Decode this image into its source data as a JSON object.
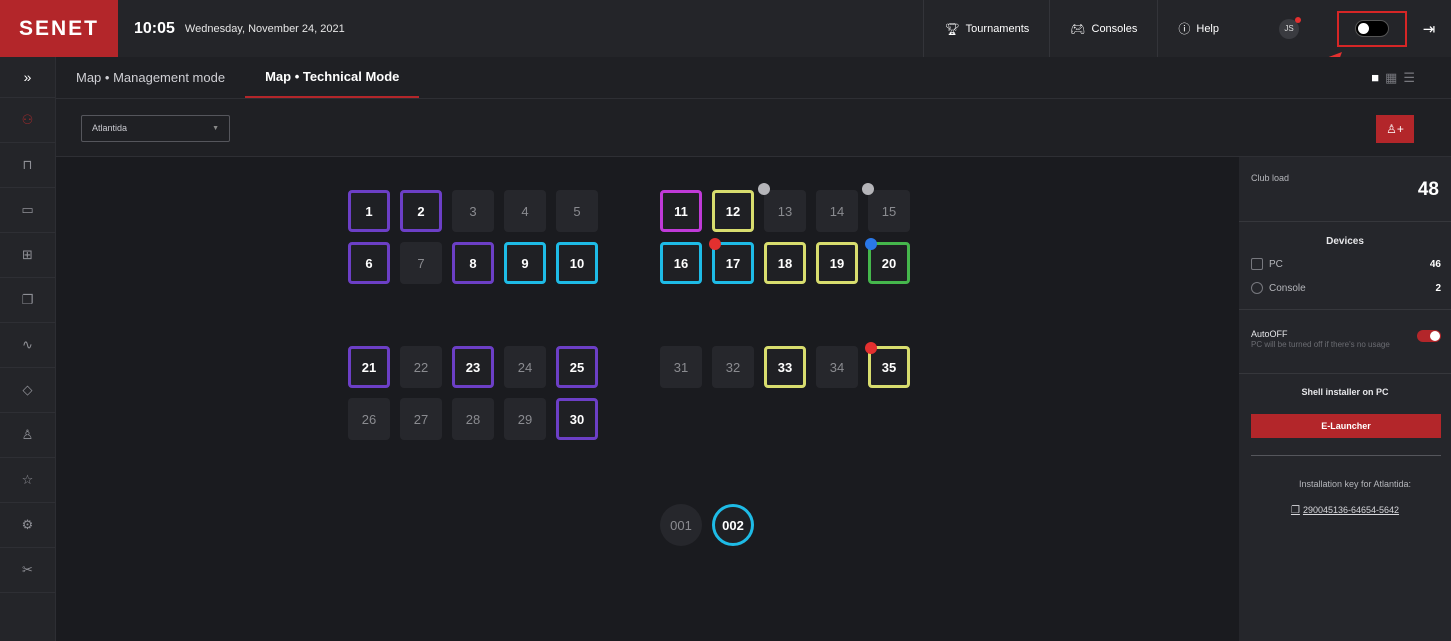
{
  "header": {
    "logo": "SENET",
    "time": "10:05",
    "date": "Wednesday, November 24, 2021",
    "nav": [
      {
        "label": "Tournaments",
        "icon": "trophy-icon"
      },
      {
        "label": "Consoles",
        "icon": "gamepad-icon"
      },
      {
        "label": "Help",
        "icon": "help-icon"
      }
    ],
    "avatar_initials": "JS"
  },
  "tabs": [
    {
      "label": "Map • Management mode",
      "active": false
    },
    {
      "label": "Map • Technical Mode",
      "active": true
    }
  ],
  "filter": {
    "club": "Atlantida"
  },
  "stations": {
    "pcs": [
      {
        "n": "1",
        "frame": "purple"
      },
      {
        "n": "2",
        "frame": "purple"
      },
      {
        "n": "3"
      },
      {
        "n": "4"
      },
      {
        "n": "5"
      },
      {
        "n": "6",
        "frame": "purple"
      },
      {
        "n": "7"
      },
      {
        "n": "8",
        "frame": "purple"
      },
      {
        "n": "9",
        "frame": "cyan"
      },
      {
        "n": "10",
        "frame": "cyan"
      },
      {
        "n": "11",
        "frame": "magenta"
      },
      {
        "n": "12",
        "frame": "yellow"
      },
      {
        "n": "13",
        "indicator": "grey"
      },
      {
        "n": "14"
      },
      {
        "n": "15",
        "indicator": "grey"
      },
      {
        "n": "16",
        "frame": "cyan"
      },
      {
        "n": "17",
        "frame": "cyan",
        "indicator": "red"
      },
      {
        "n": "18",
        "frame": "yellow"
      },
      {
        "n": "19",
        "frame": "yellow"
      },
      {
        "n": "20",
        "frame": "green",
        "indicator": "blue"
      },
      {
        "n": "21",
        "frame": "purple"
      },
      {
        "n": "22"
      },
      {
        "n": "23",
        "frame": "purple"
      },
      {
        "n": "24"
      },
      {
        "n": "25",
        "frame": "purple"
      },
      {
        "n": "26"
      },
      {
        "n": "27"
      },
      {
        "n": "28"
      },
      {
        "n": "29"
      },
      {
        "n": "30",
        "frame": "purple"
      },
      {
        "n": "31"
      },
      {
        "n": "32"
      },
      {
        "n": "33",
        "frame": "yellow"
      },
      {
        "n": "34"
      },
      {
        "n": "35",
        "frame": "yellow",
        "indicator": "red"
      }
    ],
    "consoles": [
      {
        "n": "001"
      },
      {
        "n": "002",
        "frame": "cyan"
      }
    ]
  },
  "panel": {
    "club_load_label": "Club load",
    "club_load_value": "48",
    "devices_title": "Devices",
    "devices": [
      {
        "label": "PC",
        "count": "46"
      },
      {
        "label": "Console",
        "count": "2"
      }
    ],
    "autooff_title": "AutoOFF",
    "autooff_desc": "PC will be turned off if there's no usage",
    "autooff_on": true,
    "shell_title": "Shell installer on PC",
    "elauncher_label": "E-Launcher",
    "install_key_label": "Installation key for  Atlantida:",
    "install_key": "290045136-64654-5642"
  },
  "colors": {
    "brand": "#b3262a",
    "frame_purple": "#6c3fc6",
    "frame_magenta": "#c03ad8",
    "frame_cyan": "#1ebbe6",
    "frame_yellow": "#d8dd6e",
    "frame_green": "#45b74c",
    "indicator_red": "#e3302f",
    "indicator_grey": "#b5b5b9",
    "indicator_blue": "#2a78e8"
  }
}
